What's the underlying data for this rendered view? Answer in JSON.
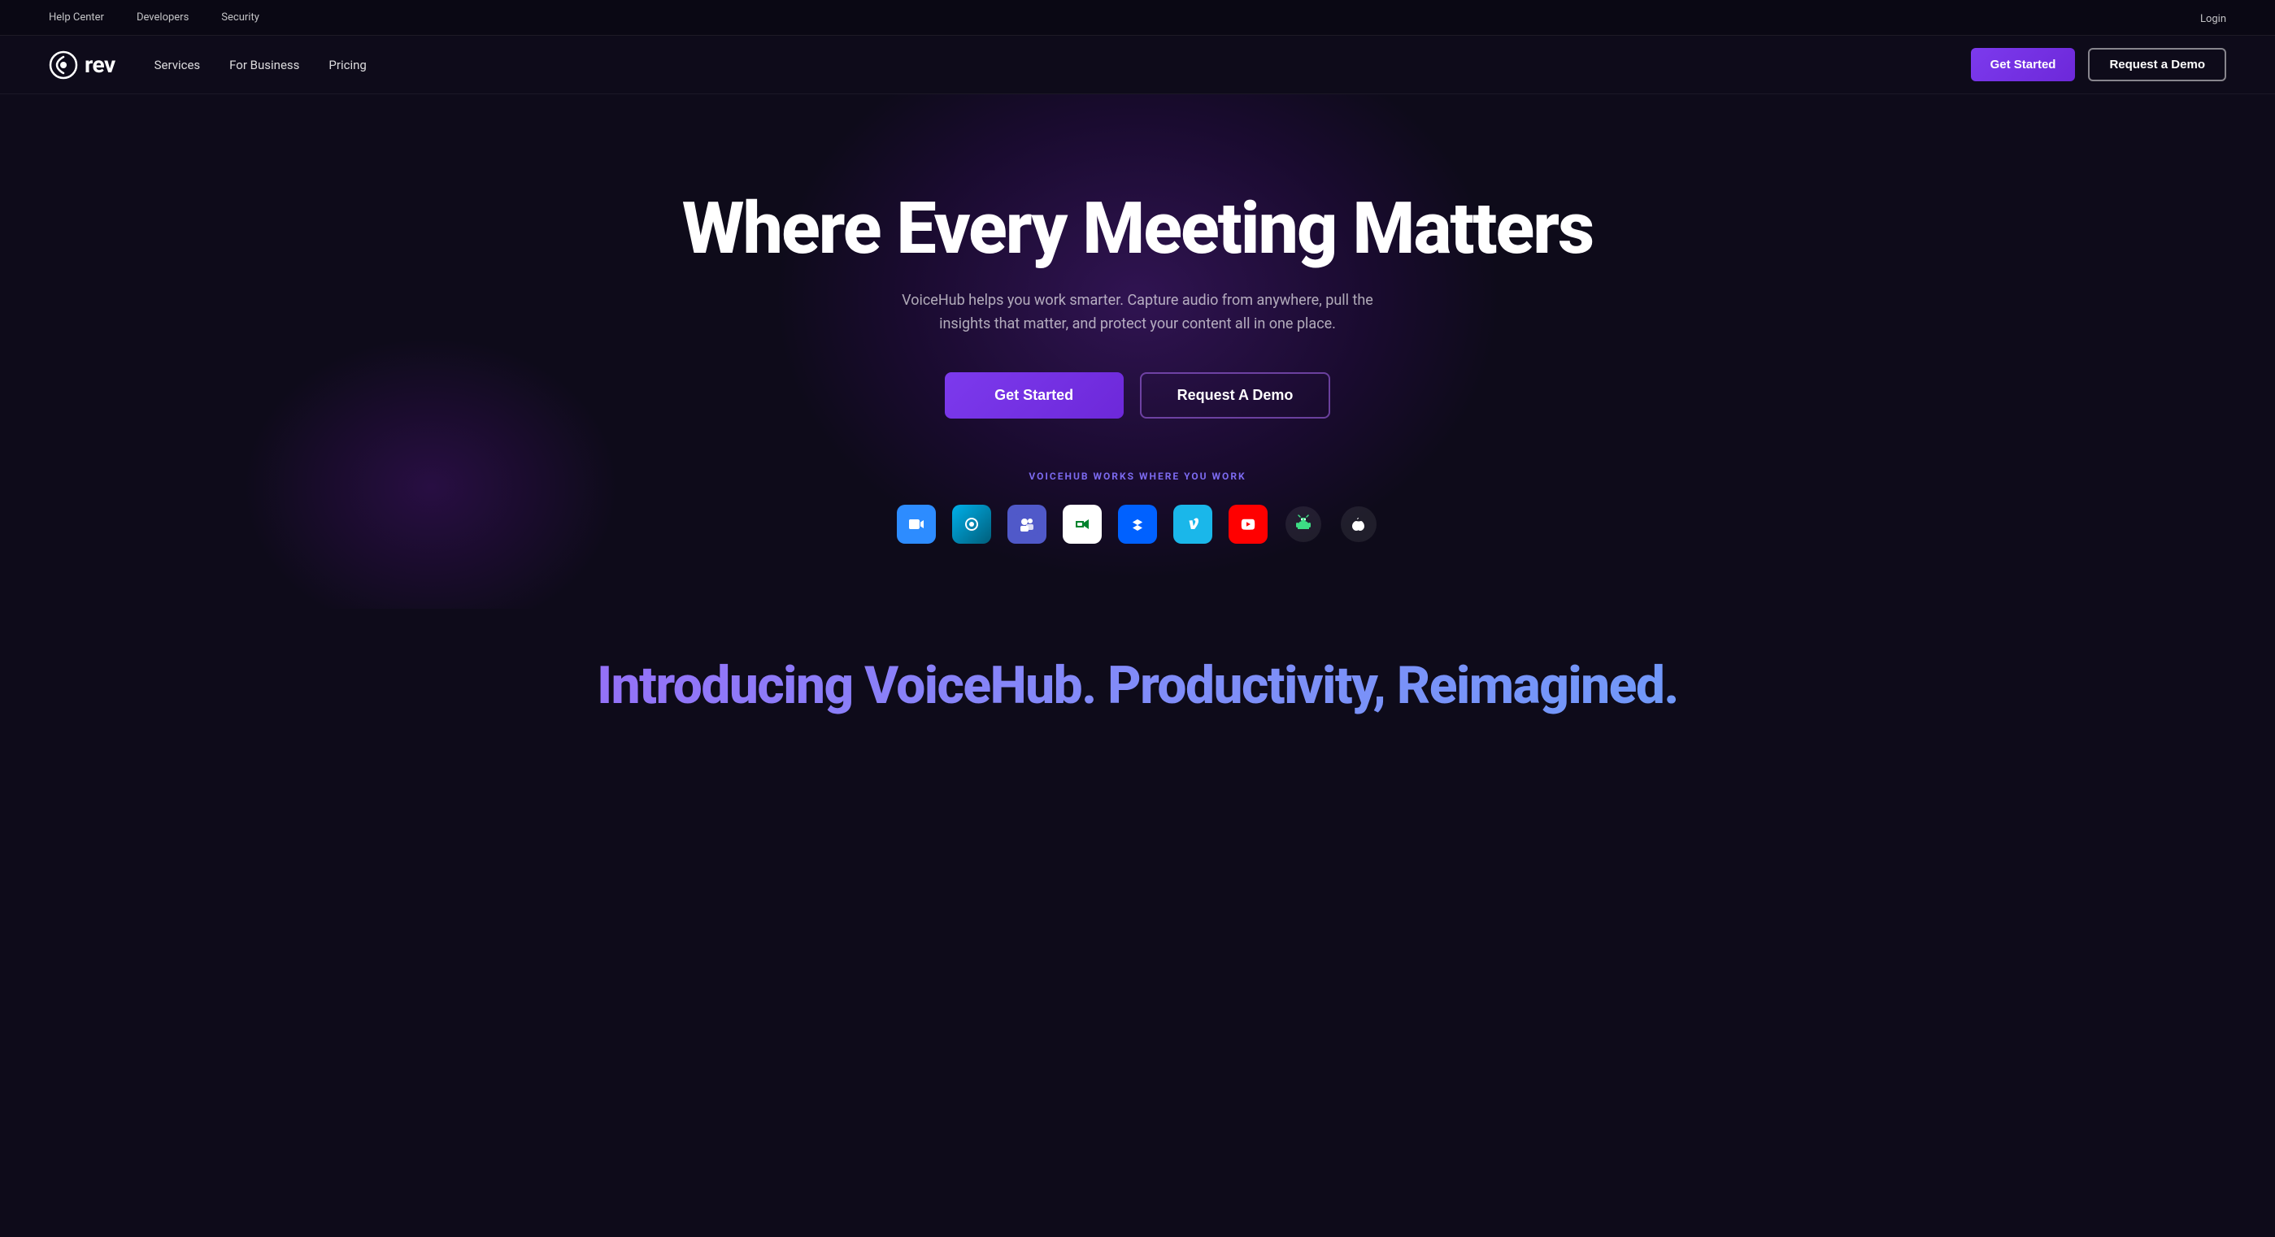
{
  "topbar": {
    "links": [
      {
        "id": "help-center",
        "label": "Help Center"
      },
      {
        "id": "developers",
        "label": "Developers"
      },
      {
        "id": "security",
        "label": "Security"
      }
    ],
    "login_label": "Login"
  },
  "nav": {
    "logo_text": "rev",
    "links": [
      {
        "id": "services",
        "label": "Services"
      },
      {
        "id": "for-business",
        "label": "For Business"
      },
      {
        "id": "pricing",
        "label": "Pricing"
      }
    ],
    "get_started_label": "Get Started",
    "request_demo_label": "Request a Demo"
  },
  "hero": {
    "title": "Where Every Meeting Matters",
    "subtitle": "VoiceHub helps you work smarter. Capture audio from anywhere, pull the insights that matter, and protect your content all in one place.",
    "get_started_label": "Get Started",
    "request_demo_label": "Request A Demo",
    "works_label": "VOICEHUB WORKS WHERE YOU WORK",
    "integrations": [
      {
        "id": "zoom",
        "label": "Zoom",
        "color": "#2D8CFF"
      },
      {
        "id": "webex",
        "label": "Webex",
        "color": "#00B0EA"
      },
      {
        "id": "teams",
        "label": "Microsoft Teams",
        "color": "#5059C9"
      },
      {
        "id": "meet",
        "label": "Google Meet",
        "color": "#ffffff"
      },
      {
        "id": "dropbox",
        "label": "Dropbox",
        "color": "#0061FF"
      },
      {
        "id": "vimeo",
        "label": "Vimeo",
        "color": "#1AB7EA"
      },
      {
        "id": "youtube",
        "label": "YouTube",
        "color": "#FF0000"
      },
      {
        "id": "android",
        "label": "Android",
        "color": "#3DDC84"
      },
      {
        "id": "apple",
        "label": "Apple",
        "color": "#ffffff"
      }
    ]
  },
  "intro": {
    "title": "Introducing VoiceHub. Productivity, Reimagined."
  }
}
